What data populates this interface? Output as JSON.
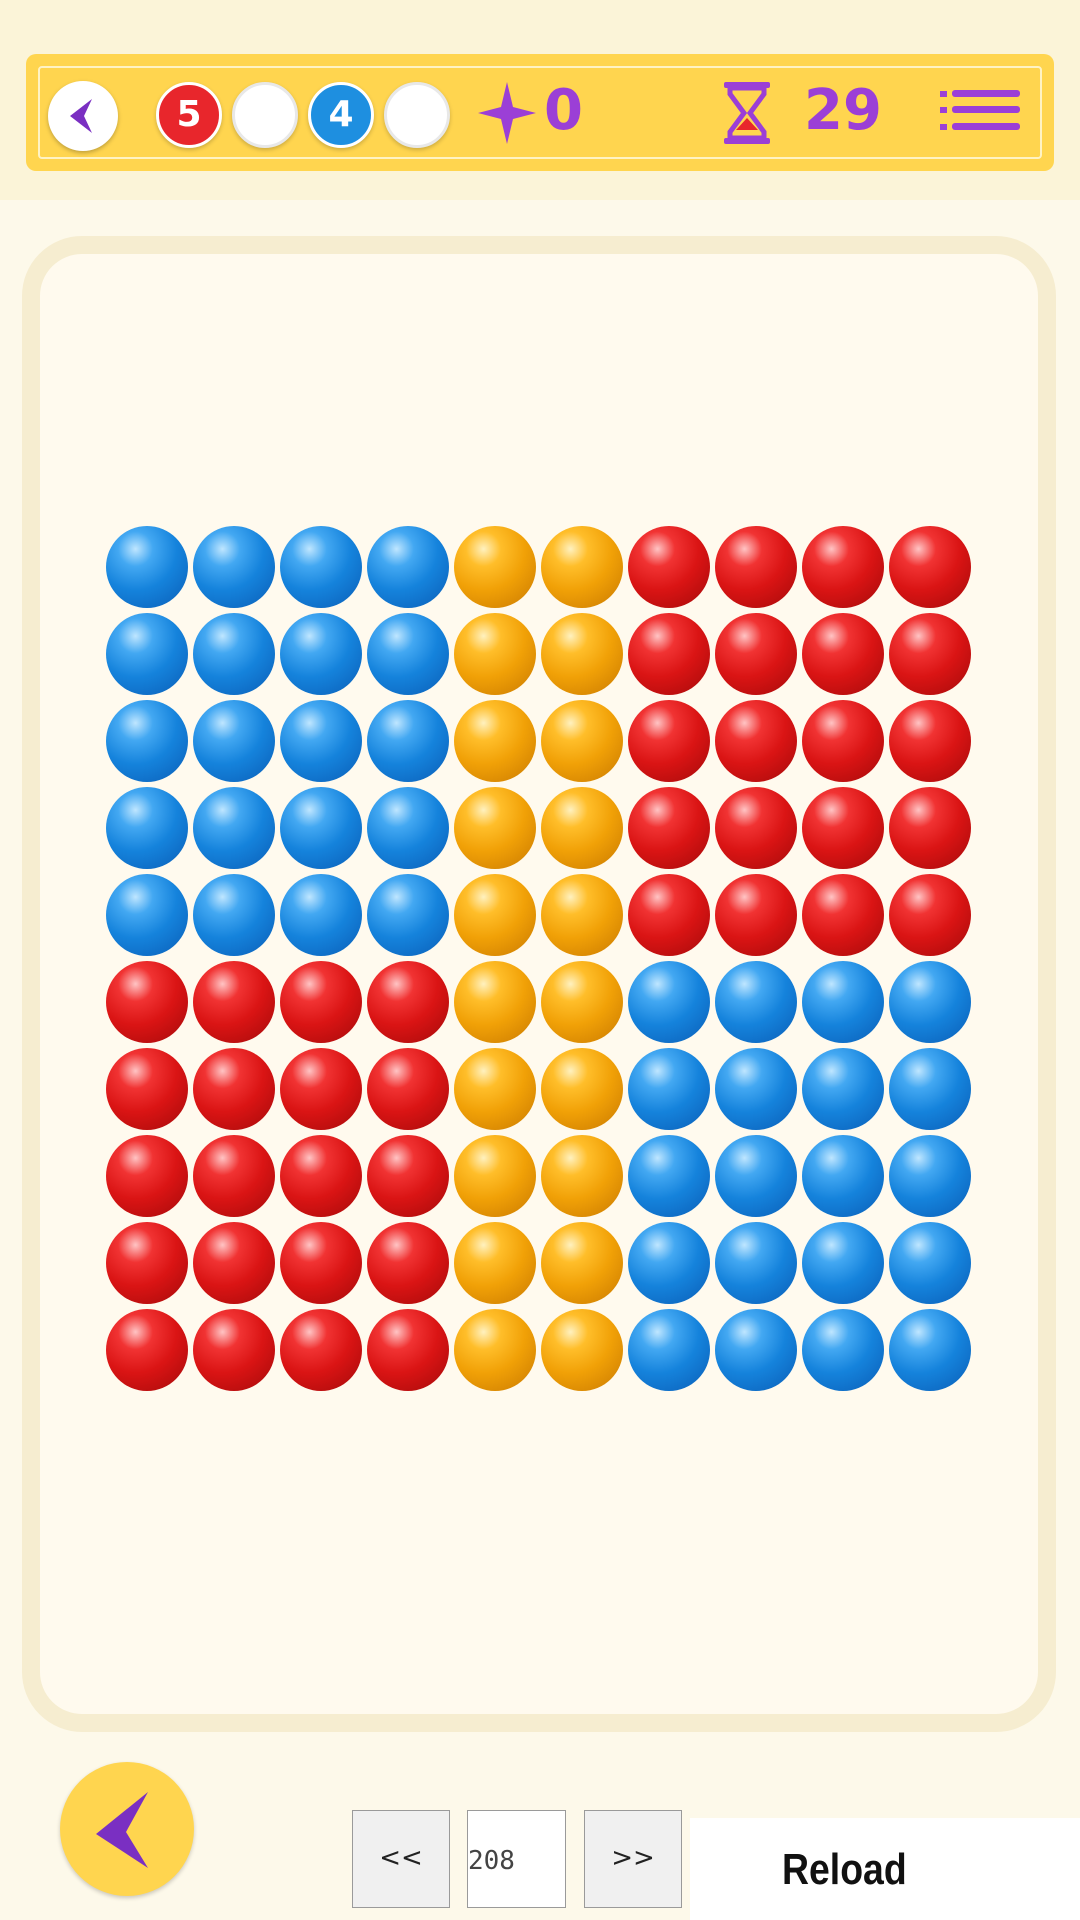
{
  "hud": {
    "goals": [
      {
        "color": "red",
        "count": "5"
      },
      {
        "color": "empty",
        "count": ""
      },
      {
        "color": "blue",
        "count": "4"
      },
      {
        "color": "empty",
        "count": ""
      }
    ],
    "score": "0",
    "timer": "29",
    "icons": {
      "back": "back-arrow-icon",
      "star": "star-icon",
      "timer": "hourglass-icon",
      "menu": "menu-list-icon"
    }
  },
  "board": {
    "rows": [
      [
        "blue",
        "blue",
        "blue",
        "blue",
        "orange",
        "orange",
        "red",
        "red",
        "red",
        "red"
      ],
      [
        "blue",
        "blue",
        "blue",
        "blue",
        "orange",
        "orange",
        "red",
        "red",
        "red",
        "red"
      ],
      [
        "blue",
        "blue",
        "blue",
        "blue",
        "orange",
        "orange",
        "red",
        "red",
        "red",
        "red"
      ],
      [
        "blue",
        "blue",
        "blue",
        "blue",
        "orange",
        "orange",
        "red",
        "red",
        "red",
        "red"
      ],
      [
        "blue",
        "blue",
        "blue",
        "blue",
        "orange",
        "orange",
        "red",
        "red",
        "red",
        "red"
      ],
      [
        "red",
        "red",
        "red",
        "red",
        "orange",
        "orange",
        "blue",
        "blue",
        "blue",
        "blue"
      ],
      [
        "red",
        "red",
        "red",
        "red",
        "orange",
        "orange",
        "blue",
        "blue",
        "blue",
        "blue"
      ],
      [
        "red",
        "red",
        "red",
        "red",
        "orange",
        "orange",
        "blue",
        "blue",
        "blue",
        "blue"
      ],
      [
        "red",
        "red",
        "red",
        "red",
        "orange",
        "orange",
        "blue",
        "blue",
        "blue",
        "blue"
      ],
      [
        "red",
        "red",
        "red",
        "red",
        "orange",
        "orange",
        "blue",
        "blue",
        "blue",
        "blue"
      ]
    ]
  },
  "controls": {
    "prev_label": "<<",
    "next_label": ">>",
    "level_value": "208",
    "reload_label": "Reload"
  },
  "colors": {
    "accent": "#ffd54f",
    "purple": "#9b3fd6",
    "background": "#fdf9ea"
  }
}
